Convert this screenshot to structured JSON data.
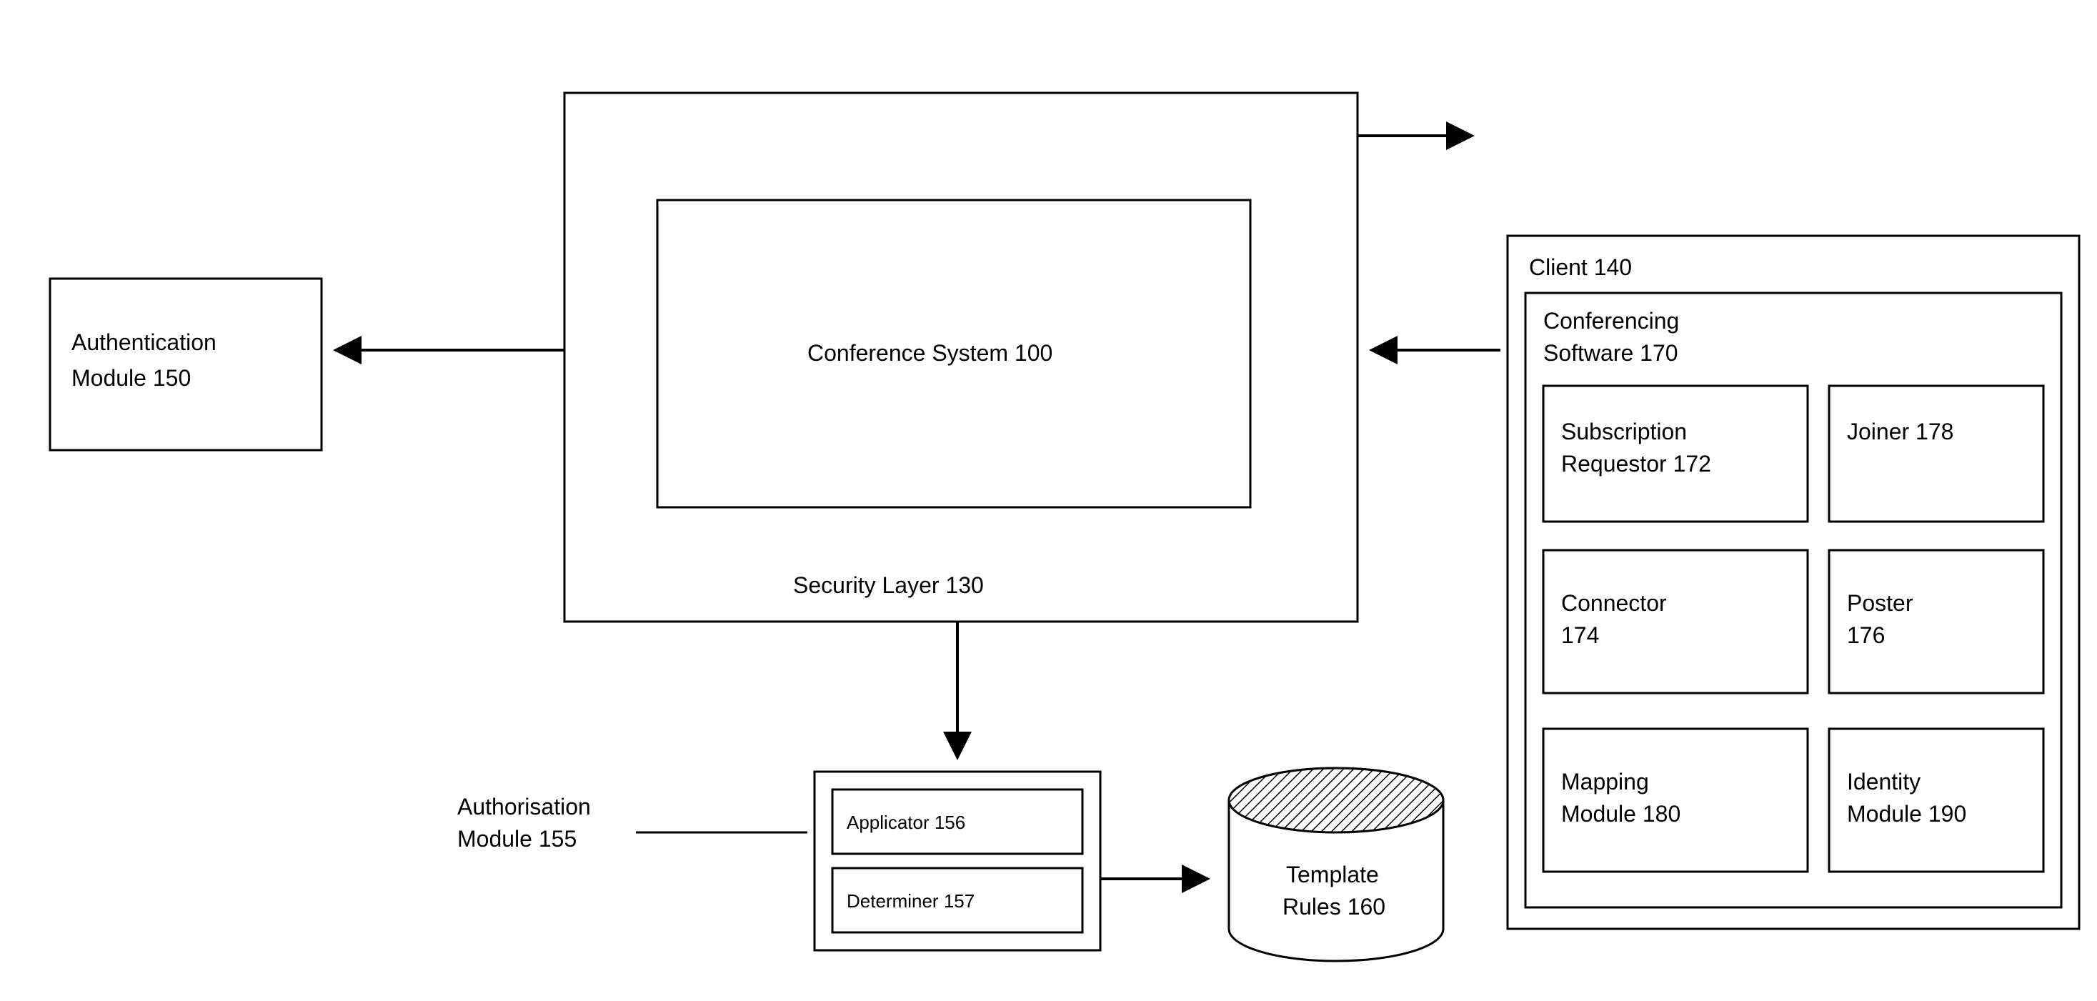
{
  "authModule": {
    "line1": "Authentication",
    "line2": "Module 150"
  },
  "securityLayer": {
    "title": "Security Layer 130"
  },
  "conferenceSystem": {
    "title": "Conference System 100"
  },
  "authzModule": {
    "line1": "Authorisation",
    "line2": "Module 155",
    "applicator": "Applicator 156",
    "determiner": "Determiner 157"
  },
  "templateRules": {
    "line1": "Template",
    "line2": "Rules 160"
  },
  "client": {
    "title": "Client 140"
  },
  "confSoftware": {
    "line1": "Conferencing",
    "line2": "Software 170"
  },
  "subReq": {
    "line1": "Subscription",
    "line2": "Requestor 172"
  },
  "joiner": {
    "title": "Joiner 178"
  },
  "connector": {
    "line1": "Connector",
    "line2": "174"
  },
  "poster": {
    "line1": "Poster",
    "line2": "176"
  },
  "mapping": {
    "line1": "Mapping",
    "line2": "Module 180"
  },
  "identity": {
    "line1": "Identity",
    "line2": "Module 190"
  }
}
